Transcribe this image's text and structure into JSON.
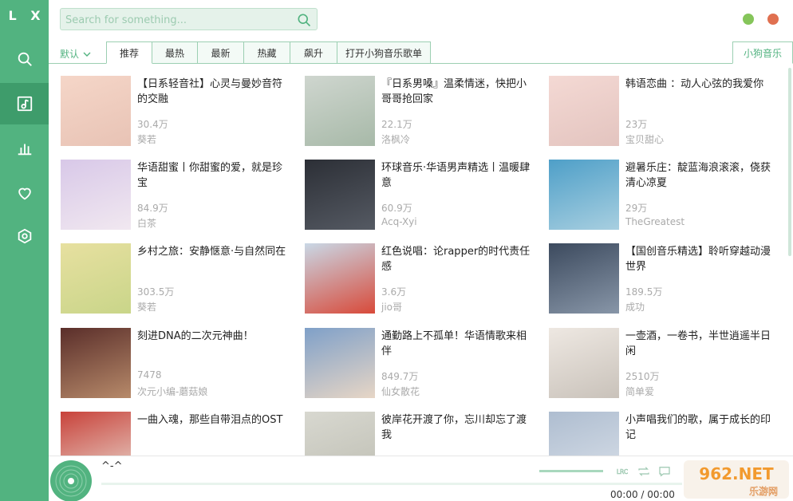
{
  "app": {
    "logo": "L X"
  },
  "search": {
    "placeholder": "Search for something..."
  },
  "tabs": {
    "sort_label": "默认",
    "items": [
      "推荐",
      "最热",
      "最新",
      "热藏",
      "飙升",
      "打开小狗音乐歌单"
    ],
    "active": "推荐",
    "source": "小狗音乐"
  },
  "playlists": [
    {
      "title": "【日系轻音社】心灵与曼妙音符的交融",
      "plays": "30.4万",
      "author": "葵若"
    },
    {
      "title": "『日系男嗓』温柔情迷，快把小哥哥抢回家",
      "plays": "22.1万",
      "author": "洛枫冷"
    },
    {
      "title": "韩语恋曲 ：动人心弦的我爱你",
      "plays": "23万",
      "author": "宝贝甜心"
    },
    {
      "title": "华语甜蜜丨你甜蜜的爱，就是珍宝",
      "plays": "84.9万",
      "author": "白茶"
    },
    {
      "title": "环球音乐·华语男声精选丨温暖肆意",
      "plays": "60.9万",
      "author": "Acq-Xyi"
    },
    {
      "title": "避暑乐庄：靛蓝海浪滚滚，侥获清心凉夏",
      "plays": "29万",
      "author": "TheGreatest"
    },
    {
      "title": "乡村之旅：安静惬意·与自然同在",
      "plays": "303.5万",
      "author": "葵若"
    },
    {
      "title": "红色说唱：论rapper的时代责任感",
      "plays": "3.6万",
      "author": "jio哥"
    },
    {
      "title": "【国创音乐精选】聆听穿越动漫世界",
      "plays": "189.5万",
      "author": "成功"
    },
    {
      "title": "刻进DNA的二次元神曲！",
      "plays": "7478",
      "author": "次元小编-蘑菇娘"
    },
    {
      "title": "通勤路上不孤单！华语情歌来相伴",
      "plays": "849.7万",
      "author": "仙女散花"
    },
    {
      "title": "一壶酒，一卷书，半世逍遥半日闲",
      "plays": "2510万",
      "author": "简单爱"
    },
    {
      "title": "一曲入魂，那些自带泪点的OST",
      "plays": "",
      "author": ""
    },
    {
      "title": "彼岸花开渡了你，忘川却忘了渡我",
      "plays": "",
      "author": ""
    },
    {
      "title": "小声唱我们的歌，属于成长的印记",
      "plays": "",
      "author": ""
    }
  ],
  "player": {
    "song": "^-^",
    "time": "00:00 / 00:00",
    "lrc_label": "LRC"
  },
  "watermark": {
    "text": "962.NET",
    "subtext": "乐游网"
  },
  "colors": {
    "accent": "#52b380",
    "accent_dark": "#3e9c6b"
  }
}
